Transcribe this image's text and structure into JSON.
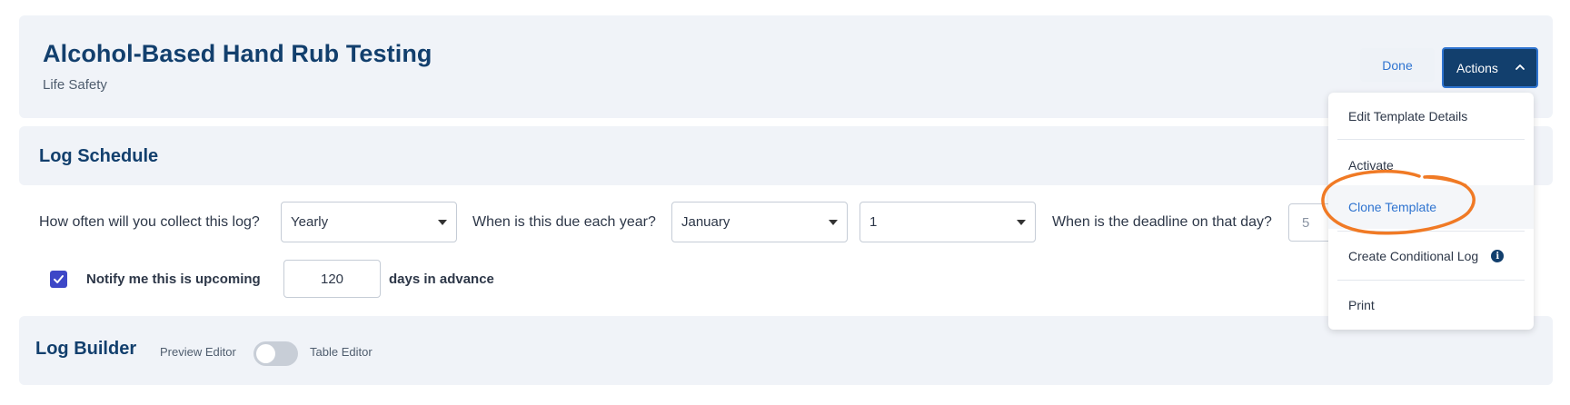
{
  "header": {
    "title": "Alcohol-Based Hand Rub Testing",
    "subtitle": "Life Safety",
    "done_label": "Done",
    "actions_label": "Actions"
  },
  "schedule": {
    "title": "Log Schedule",
    "frequency_question": "How often will you collect this log?",
    "frequency_value": "Yearly",
    "due_question": "When is this due each year?",
    "due_month": "January",
    "due_day": "1",
    "deadline_question": "When is the deadline on that day?",
    "deadline_value": "5",
    "notify_checked": true,
    "notify_label": "Notify me this is upcoming",
    "notify_days": "120",
    "days_label": "days in advance"
  },
  "builder": {
    "title": "Log Builder",
    "preview_label": "Preview Editor",
    "table_label": "Table Editor",
    "toggle_on": false
  },
  "actions_menu": {
    "items": [
      {
        "label": "Edit Template Details"
      },
      {
        "label": "Activate"
      },
      {
        "label": "Clone Template"
      },
      {
        "label": "Create Conditional Log"
      },
      {
        "label": "Print"
      }
    ]
  },
  "colors": {
    "brand_navy": "#123f6d",
    "link_blue": "#2f74d0",
    "checkbox": "#3d47c7",
    "annotation_orange": "#f07a25",
    "panel_bg": "#f0f3f8"
  }
}
